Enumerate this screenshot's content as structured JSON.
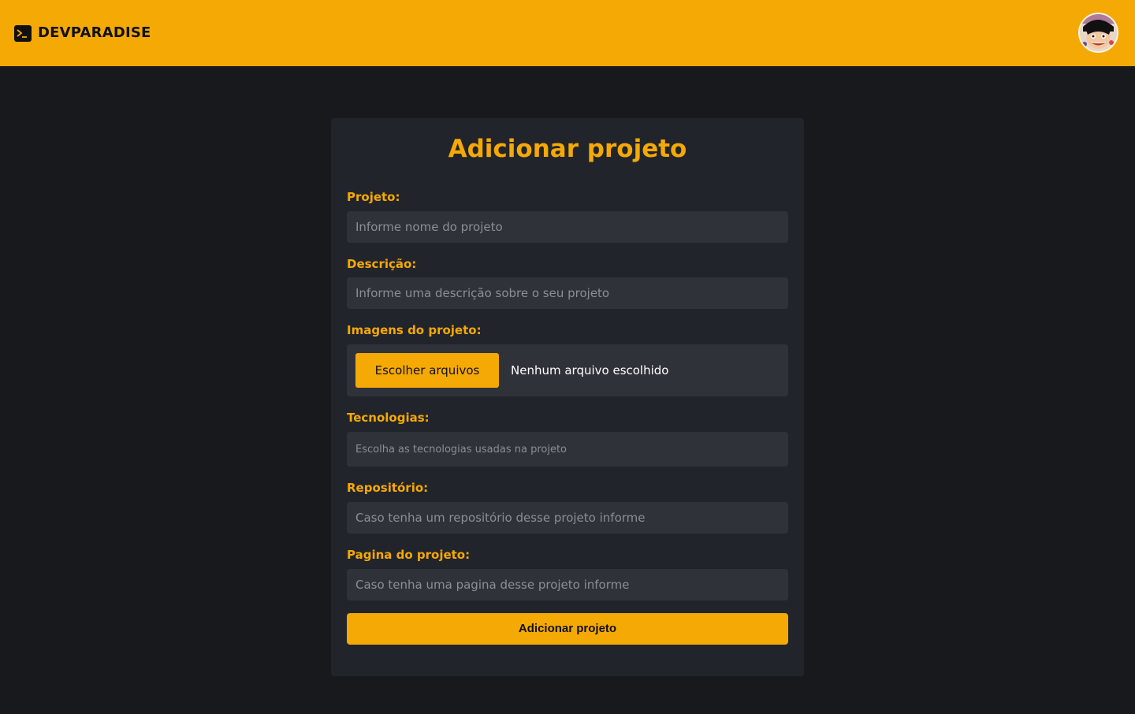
{
  "header": {
    "brand_name": "DEVPARADISE",
    "brand_icon": "terminal-icon",
    "avatar_icon": "user-avatar",
    "background_color": "#f5a905"
  },
  "form": {
    "title": "Adicionar projeto",
    "accent_color": "#f5a905",
    "fields": {
      "projeto": {
        "label": "Projeto:",
        "placeholder": "Informe nome do projeto",
        "value": ""
      },
      "descricao": {
        "label": "Descrição:",
        "placeholder": "Informe uma descrição sobre o seu projeto",
        "value": ""
      },
      "imagens": {
        "label": "Imagens do projeto:",
        "button_label": "Escolher arquivos",
        "status": "Nenhum arquivo escolhido"
      },
      "tecnologias": {
        "label": "Tecnologias:",
        "placeholder": "Escolha as tecnologias usadas na projeto",
        "value": ""
      },
      "repositorio": {
        "label": "Repositório:",
        "placeholder": "Caso tenha um repositório desse projeto informe",
        "value": ""
      },
      "pagina": {
        "label": "Pagina do projeto:",
        "placeholder": "Caso tenha uma pagina desse projeto informe",
        "value": ""
      }
    },
    "submit_label": "Adicionar projeto"
  }
}
